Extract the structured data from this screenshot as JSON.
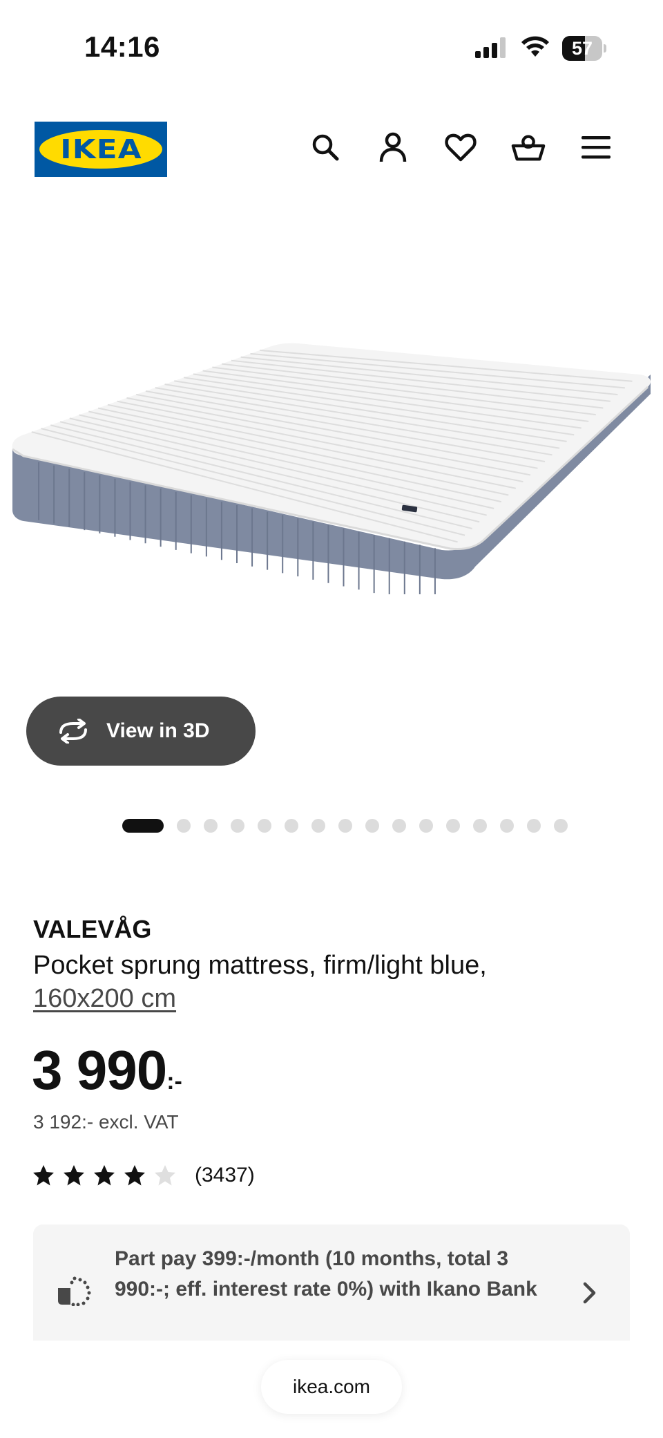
{
  "status_bar": {
    "time": "14:16",
    "battery_level": "57",
    "icons": [
      "signal-icon",
      "wifi-icon",
      "battery-icon"
    ]
  },
  "header": {
    "logo_text": "IKEA",
    "icons": [
      "search-icon",
      "account-icon",
      "heart-icon",
      "basket-icon",
      "menu-icon"
    ],
    "brand_colors": {
      "blue": "#0058a3",
      "yellow": "#ffdb00"
    }
  },
  "gallery": {
    "view3d_label": "View in 3D",
    "dot_count": 16,
    "active_index": 0
  },
  "product": {
    "name": "VALEVÅG",
    "description": "Pocket sprung mattress, firm/light blue,",
    "size": "160x200 cm",
    "price_main": "3 990",
    "price_suffix": ":-",
    "price_excl_vat": "3 192:- excl. VAT",
    "rating_stars": 4,
    "rating_max": 5,
    "review_count": "(3437)"
  },
  "part_pay": {
    "text": "Part pay 399:-/month (10 months, total 3 990:-; eff. interest rate 0%) with Ikano Bank"
  },
  "browser": {
    "url": "ikea.com"
  }
}
